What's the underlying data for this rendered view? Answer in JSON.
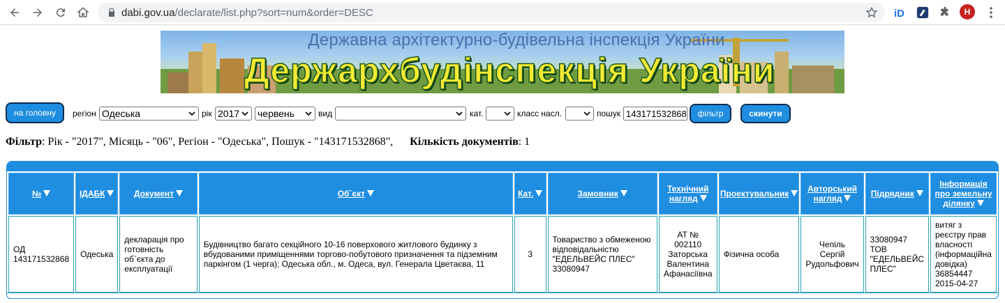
{
  "browser": {
    "url_host": "dabi.gov.ua",
    "url_path": "/declarate/list.php?sort=num&order=DESC",
    "profile_initial": "H"
  },
  "banner": {
    "subtitle": "Державна архітектурно-будівельна інспекція України",
    "title": "Держархбудінспекція України"
  },
  "filters": {
    "home_label": "на головну",
    "region_label": "регіон",
    "region_value": "Одеська",
    "year_label": "рік",
    "year_value": "2017",
    "month_value": "червень",
    "kind_label": "вид",
    "kind_value": "",
    "cat_label": "кат.",
    "cat_value": "",
    "class_label": "класс насл.",
    "class_value": "",
    "search_label": "пошук",
    "search_value": "143171532868",
    "filter_button": "фільтр",
    "reset_button": "скинути"
  },
  "summary": {
    "filter_label": "Фільтр",
    "filter_text": ": Рік - \"2017\", Місяць - \"06\", Регіон - \"Одеська\", Пошук - \"143171532868\",",
    "count_label": "Кількість документів",
    "count_value": ": 1"
  },
  "table": {
    "headers": {
      "num": "№",
      "idabk": "ІДАБК",
      "doc": "Документ",
      "object": "Об`єкт",
      "cat": "Кат.",
      "customer": "Замовник",
      "tech1": "Технічний",
      "tech2": "нагляд",
      "designer": "Проектувальник",
      "author1": "Авторський",
      "author2": "нагляд",
      "contractor": "Підрядник",
      "land1": "Інформація",
      "land2": "про земельну",
      "land3": "ділянку"
    },
    "row": {
      "num1": "ОД",
      "num2": "143171532868",
      "idabk": "Одеська",
      "doc": "декларація про готовність об`єкта до експлуатації",
      "object": "Будівництво багато секційного 10-16 поверхового житлового будинку з вбудованими приміщеннями торгово-побутового призначення та підземним паркінгом (1 черга); Одеська обл., м. Одеса, вул. Генерала Цветаєва, 11",
      "cat": "3",
      "customer": "Товариство з обмеженою відповідальністю \"ЕДЕЛЬВЕЙС ПЛЕС\" 33080947",
      "tech": "АТ № 002110 Заторська Валентина Афанасіївна",
      "designer": "Фізична особа",
      "author": "Чепіль Сергій Рудольфович",
      "contractor": "33080947 ТОВ \"ЕДЕЛЬВЕЙС ПЛЕС\"",
      "land": "витяг з реєстру прав власності (інформаційна довідка) 36854447 2015-04-27"
    }
  },
  "colors": {
    "accent": "#1f8de0",
    "cell_border": "#2aa0b5",
    "banner_title": "#f4ea33"
  }
}
